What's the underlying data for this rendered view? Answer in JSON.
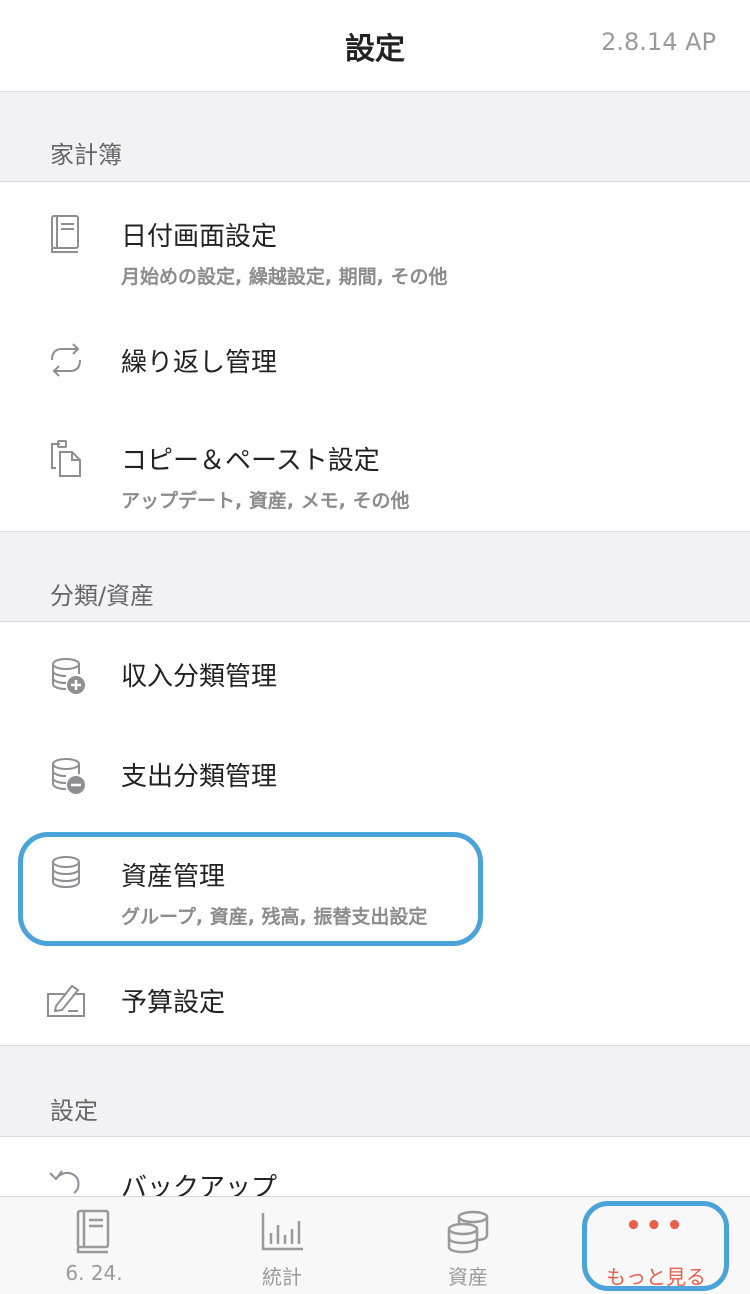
{
  "header": {
    "title": "設定",
    "version": "2.8.14 AP"
  },
  "sections": [
    {
      "label": "家計簿"
    },
    {
      "label": "分類/資産"
    },
    {
      "label": "設定"
    }
  ],
  "rows": {
    "date_screen": {
      "title": "日付画面設定",
      "subtitle": "月始めの設定, 繰越設定, 期間, その他",
      "icon": "book-icon"
    },
    "repeat": {
      "title": "繰り返し管理",
      "icon": "repeat-icon"
    },
    "copy_paste": {
      "title": "コピー＆ペースト設定",
      "subtitle": "アップデート, 資産, メモ, その他",
      "icon": "clipboard-icon"
    },
    "income_category": {
      "title": "収入分類管理",
      "icon": "coins-plus-icon"
    },
    "expense_category": {
      "title": "支出分類管理",
      "icon": "coins-minus-icon"
    },
    "asset": {
      "title": "資産管理",
      "subtitle": "グループ, 資産, 残高, 振替支出設定",
      "icon": "coins-icon"
    },
    "budget": {
      "title": "予算設定",
      "icon": "pencil-icon"
    },
    "backup": {
      "title": "バックアップ",
      "icon": "undo-icon"
    }
  },
  "tabbar": {
    "tabs": [
      {
        "label": "6. 24.",
        "icon": "book-icon"
      },
      {
        "label": "統計",
        "icon": "bar-chart-icon"
      },
      {
        "label": "資産",
        "icon": "coins-icon"
      },
      {
        "label": "もっと見る",
        "icon": "more-dots-icon",
        "dots": "•••"
      }
    ]
  },
  "colors": {
    "accent": "#e8604c",
    "highlight": "#4aa3d9",
    "icon_gray": "#8e8e93"
  }
}
